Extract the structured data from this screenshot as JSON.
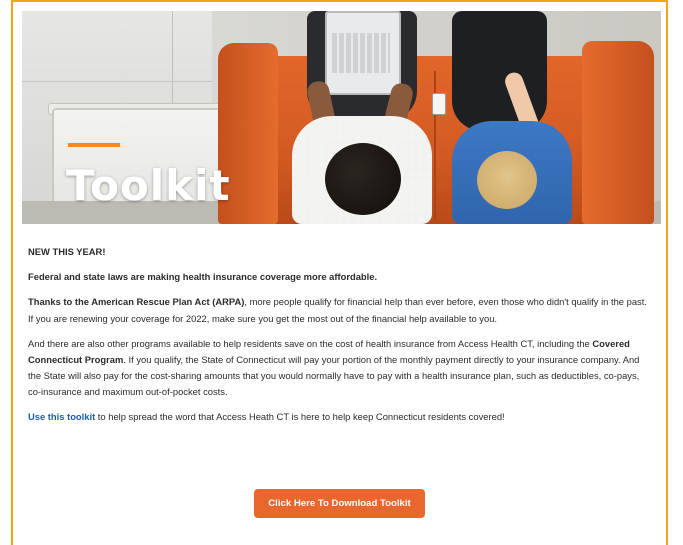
{
  "hero": {
    "title": "Toolkit"
  },
  "content": {
    "new_label": "NEW THIS YEAR!",
    "headline": "Federal and state laws are making health insurance coverage more affordable.",
    "p1_strong": "Thanks to the American Rescue Plan Act (ARPA)",
    "p1_rest": ", more people qualify for financial help than ever before, even those who didn't qualify in the past. If you are renewing your coverage for 2022, make sure you get the most out of the financial help available to you.",
    "p2_start": "And there are also other programs available to help residents save on the cost of health insurance from Access Health CT, including the ",
    "p2_strong": "Covered Connecticut Program",
    "p2_rest": ". If you qualify, the State of Connecticut will pay your portion of the monthly payment directly to your insurance company. And the State will also pay for the cost-sharing amounts that you would normally have to pay with a health insurance plan, such as deductibles, co-pays, co-insurance and maximum out-of-pocket costs.",
    "p3_link": "Use this toolkit",
    "p3_rest": " to help spread the word that Access Heath CT is here to help keep Connecticut residents covered!"
  },
  "cta": {
    "label": "Click Here To Download Toolkit"
  },
  "colors": {
    "frame_border": "#f3a21b",
    "accent_orange": "#e9662c",
    "link_blue": "#1c5fa8"
  }
}
